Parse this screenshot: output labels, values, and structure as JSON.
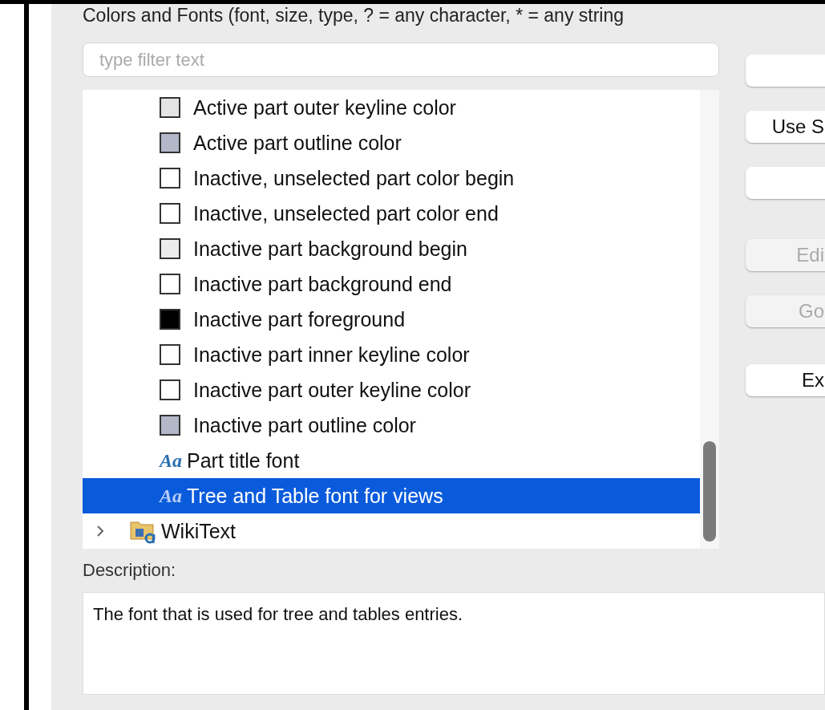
{
  "header": {
    "text": "Colors and Fonts (font, size, type, ? = any character, * = any string"
  },
  "filter": {
    "placeholder": "type filter text"
  },
  "tree": {
    "items": [
      {
        "kind": "color",
        "label": "Active part outer keyline color",
        "color": "#e4e4e4",
        "selected": false
      },
      {
        "kind": "color",
        "label": "Active part outline color",
        "color": "#b3b7c8",
        "selected": false
      },
      {
        "kind": "color",
        "label": "Inactive, unselected part color begin",
        "color": "#ffffff",
        "selected": false
      },
      {
        "kind": "color",
        "label": "Inactive, unselected part color end",
        "color": "#ffffff",
        "selected": false
      },
      {
        "kind": "color",
        "label": "Inactive part background begin",
        "color": "#ececec",
        "selected": false
      },
      {
        "kind": "color",
        "label": "Inactive part background end",
        "color": "#ffffff",
        "selected": false
      },
      {
        "kind": "color",
        "label": "Inactive part foreground",
        "color": "#000000",
        "selected": false
      },
      {
        "kind": "color",
        "label": "Inactive part inner keyline color",
        "color": "#ffffff",
        "selected": false
      },
      {
        "kind": "color",
        "label": "Inactive part outer keyline color",
        "color": "#ffffff",
        "selected": false
      },
      {
        "kind": "color",
        "label": "Inactive part outline color",
        "color": "#b3b7c8",
        "selected": false
      },
      {
        "kind": "font",
        "icon": "Aa",
        "label": "Part title font",
        "selected": false
      },
      {
        "kind": "font",
        "icon": "Aa",
        "label": "Tree and Table font for views",
        "selected": true
      },
      {
        "kind": "category",
        "label": "WikiText",
        "expanded": false,
        "selected": false
      }
    ]
  },
  "buttons": [
    {
      "disabled": false
    },
    {
      "label": "Use S",
      "disabled": false
    },
    {
      "disabled": false
    },
    {
      "label": "Edi",
      "disabled": true
    },
    {
      "label": "Go",
      "disabled": true
    },
    {
      "label": "Ex",
      "disabled": false
    }
  ],
  "description": {
    "label": "Description:",
    "text": "The font that is used for tree and tables entries."
  }
}
